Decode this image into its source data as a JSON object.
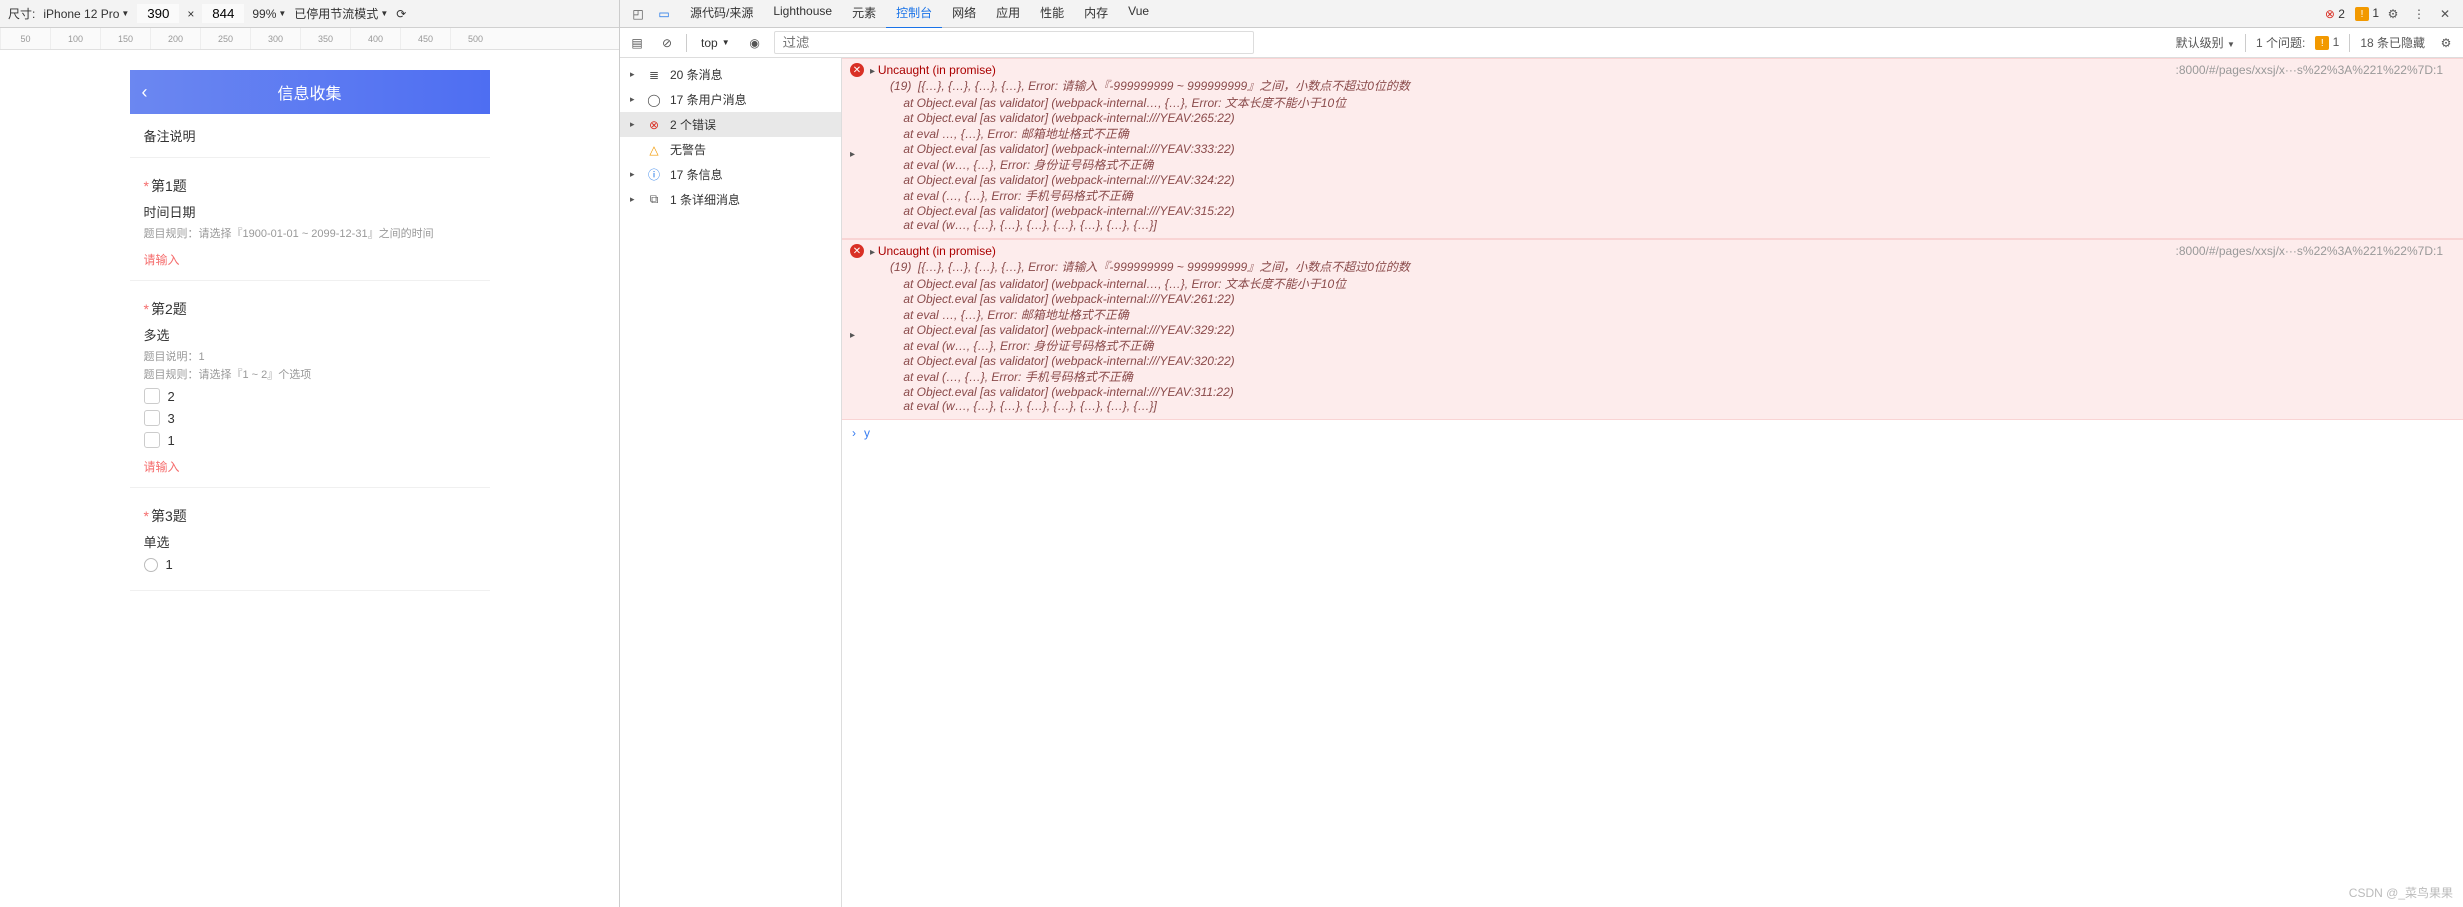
{
  "device_bar": {
    "size_label": "尺寸:",
    "device": "iPhone 12 Pro",
    "width": "390",
    "height": "844",
    "x": "×",
    "zoom": "99%",
    "throttle": "已停用节流模式"
  },
  "ruler_marks": [
    "50",
    "100",
    "150",
    "200",
    "250",
    "300",
    "350",
    "400",
    "450",
    "500"
  ],
  "app": {
    "title": "信息收集",
    "remark": "备注说明",
    "questions": [
      {
        "num": "第1题",
        "sub": "时间日期",
        "rule": "题目规则：请选择『1900-01-01 ~ 2099-12-31』之间的时间",
        "error": "请输入"
      },
      {
        "num": "第2题",
        "sub": "多选",
        "desc": "题目说明：1",
        "rule": "题目规则：请选择『1 ~ 2』个选项",
        "options": [
          "2",
          "3",
          "1"
        ],
        "error": "请输入"
      },
      {
        "num": "第3题",
        "sub": "单选",
        "options": [
          "1"
        ]
      }
    ]
  },
  "devtools_tabs": {
    "items": [
      "源代码/来源",
      "Lighthouse",
      "元素",
      "控制台",
      "网络",
      "应用",
      "性能",
      "内存",
      "Vue"
    ],
    "active": "控制台",
    "errors": "2",
    "warnings": "1"
  },
  "console_bar": {
    "context": "top",
    "filter_placeholder": "过滤",
    "level": "默认级别",
    "issues_label": "1 个问题:",
    "issues_count": "1",
    "hidden": "18 条已隐藏"
  },
  "sidebar": {
    "items": [
      {
        "icon": "list",
        "label": "20 条消息"
      },
      {
        "icon": "user",
        "label": "17 条用户消息"
      },
      {
        "icon": "error",
        "label": "2 个错误",
        "selected": true
      },
      {
        "icon": "warn",
        "label": "无警告",
        "leaf": true
      },
      {
        "icon": "info",
        "label": "17 条信息"
      },
      {
        "icon": "verbose",
        "label": "1 条详细消息"
      }
    ]
  },
  "errors": [
    {
      "summary": "Uncaught (in promise)",
      "source": ":8000/#/pages/xxsj/x···s%22%3A%221%22%7D:1",
      "lines": [
        "(19)  [{…}, {…}, {…}, {…}, Error: 请输入『-999999999 ~ 999999999』之间，小数点不超过0位的数",
        "    at Object.eval [as validator] (webpack-internal…, {…}, Error: 文本长度不能小于10位",
        "    at Object.eval [as validator] (webpack-internal:///YEAV:265:22)",
        "    at eval …, {…}, Error: 邮箱地址格式不正确",
        "    at Object.eval [as validator] (webpack-internal:///YEAV:333:22)",
        "    at eval (w…, {…}, Error: 身份证号码格式不正确",
        "    at Object.eval [as validator] (webpack-internal:///YEAV:324:22)",
        "    at eval (…, {…}, Error: 手机号码格式不正确",
        "    at Object.eval [as validator] (webpack-internal:///YEAV:315:22)",
        "    at eval (w…, {…}, {…}, {…}, {…}, {…}, {…}, {…}]"
      ]
    },
    {
      "summary": "Uncaught (in promise)",
      "source": ":8000/#/pages/xxsj/x···s%22%3A%221%22%7D:1",
      "lines": [
        "(19)  [{…}, {…}, {…}, {…}, Error: 请输入『-999999999 ~ 999999999』之间，小数点不超过0位的数",
        "    at Object.eval [as validator] (webpack-internal…, {…}, Error: 文本长度不能小于10位",
        "    at Object.eval [as validator] (webpack-internal:///YEAV:261:22)",
        "    at eval …, {…}, Error: 邮箱地址格式不正确",
        "    at Object.eval [as validator] (webpack-internal:///YEAV:329:22)",
        "    at eval (w…, {…}, Error: 身份证号码格式不正确",
        "    at Object.eval [as validator] (webpack-internal:///YEAV:320:22)",
        "    at eval (…, {…}, Error: 手机号码格式不正确",
        "    at Object.eval [as validator] (webpack-internal:///YEAV:311:22)",
        "    at eval (w…, {…}, {…}, {…}, {…}, {…}, {…}, {…}]"
      ]
    }
  ],
  "prompt": "y",
  "watermark": "CSDN @_菜鸟果果"
}
